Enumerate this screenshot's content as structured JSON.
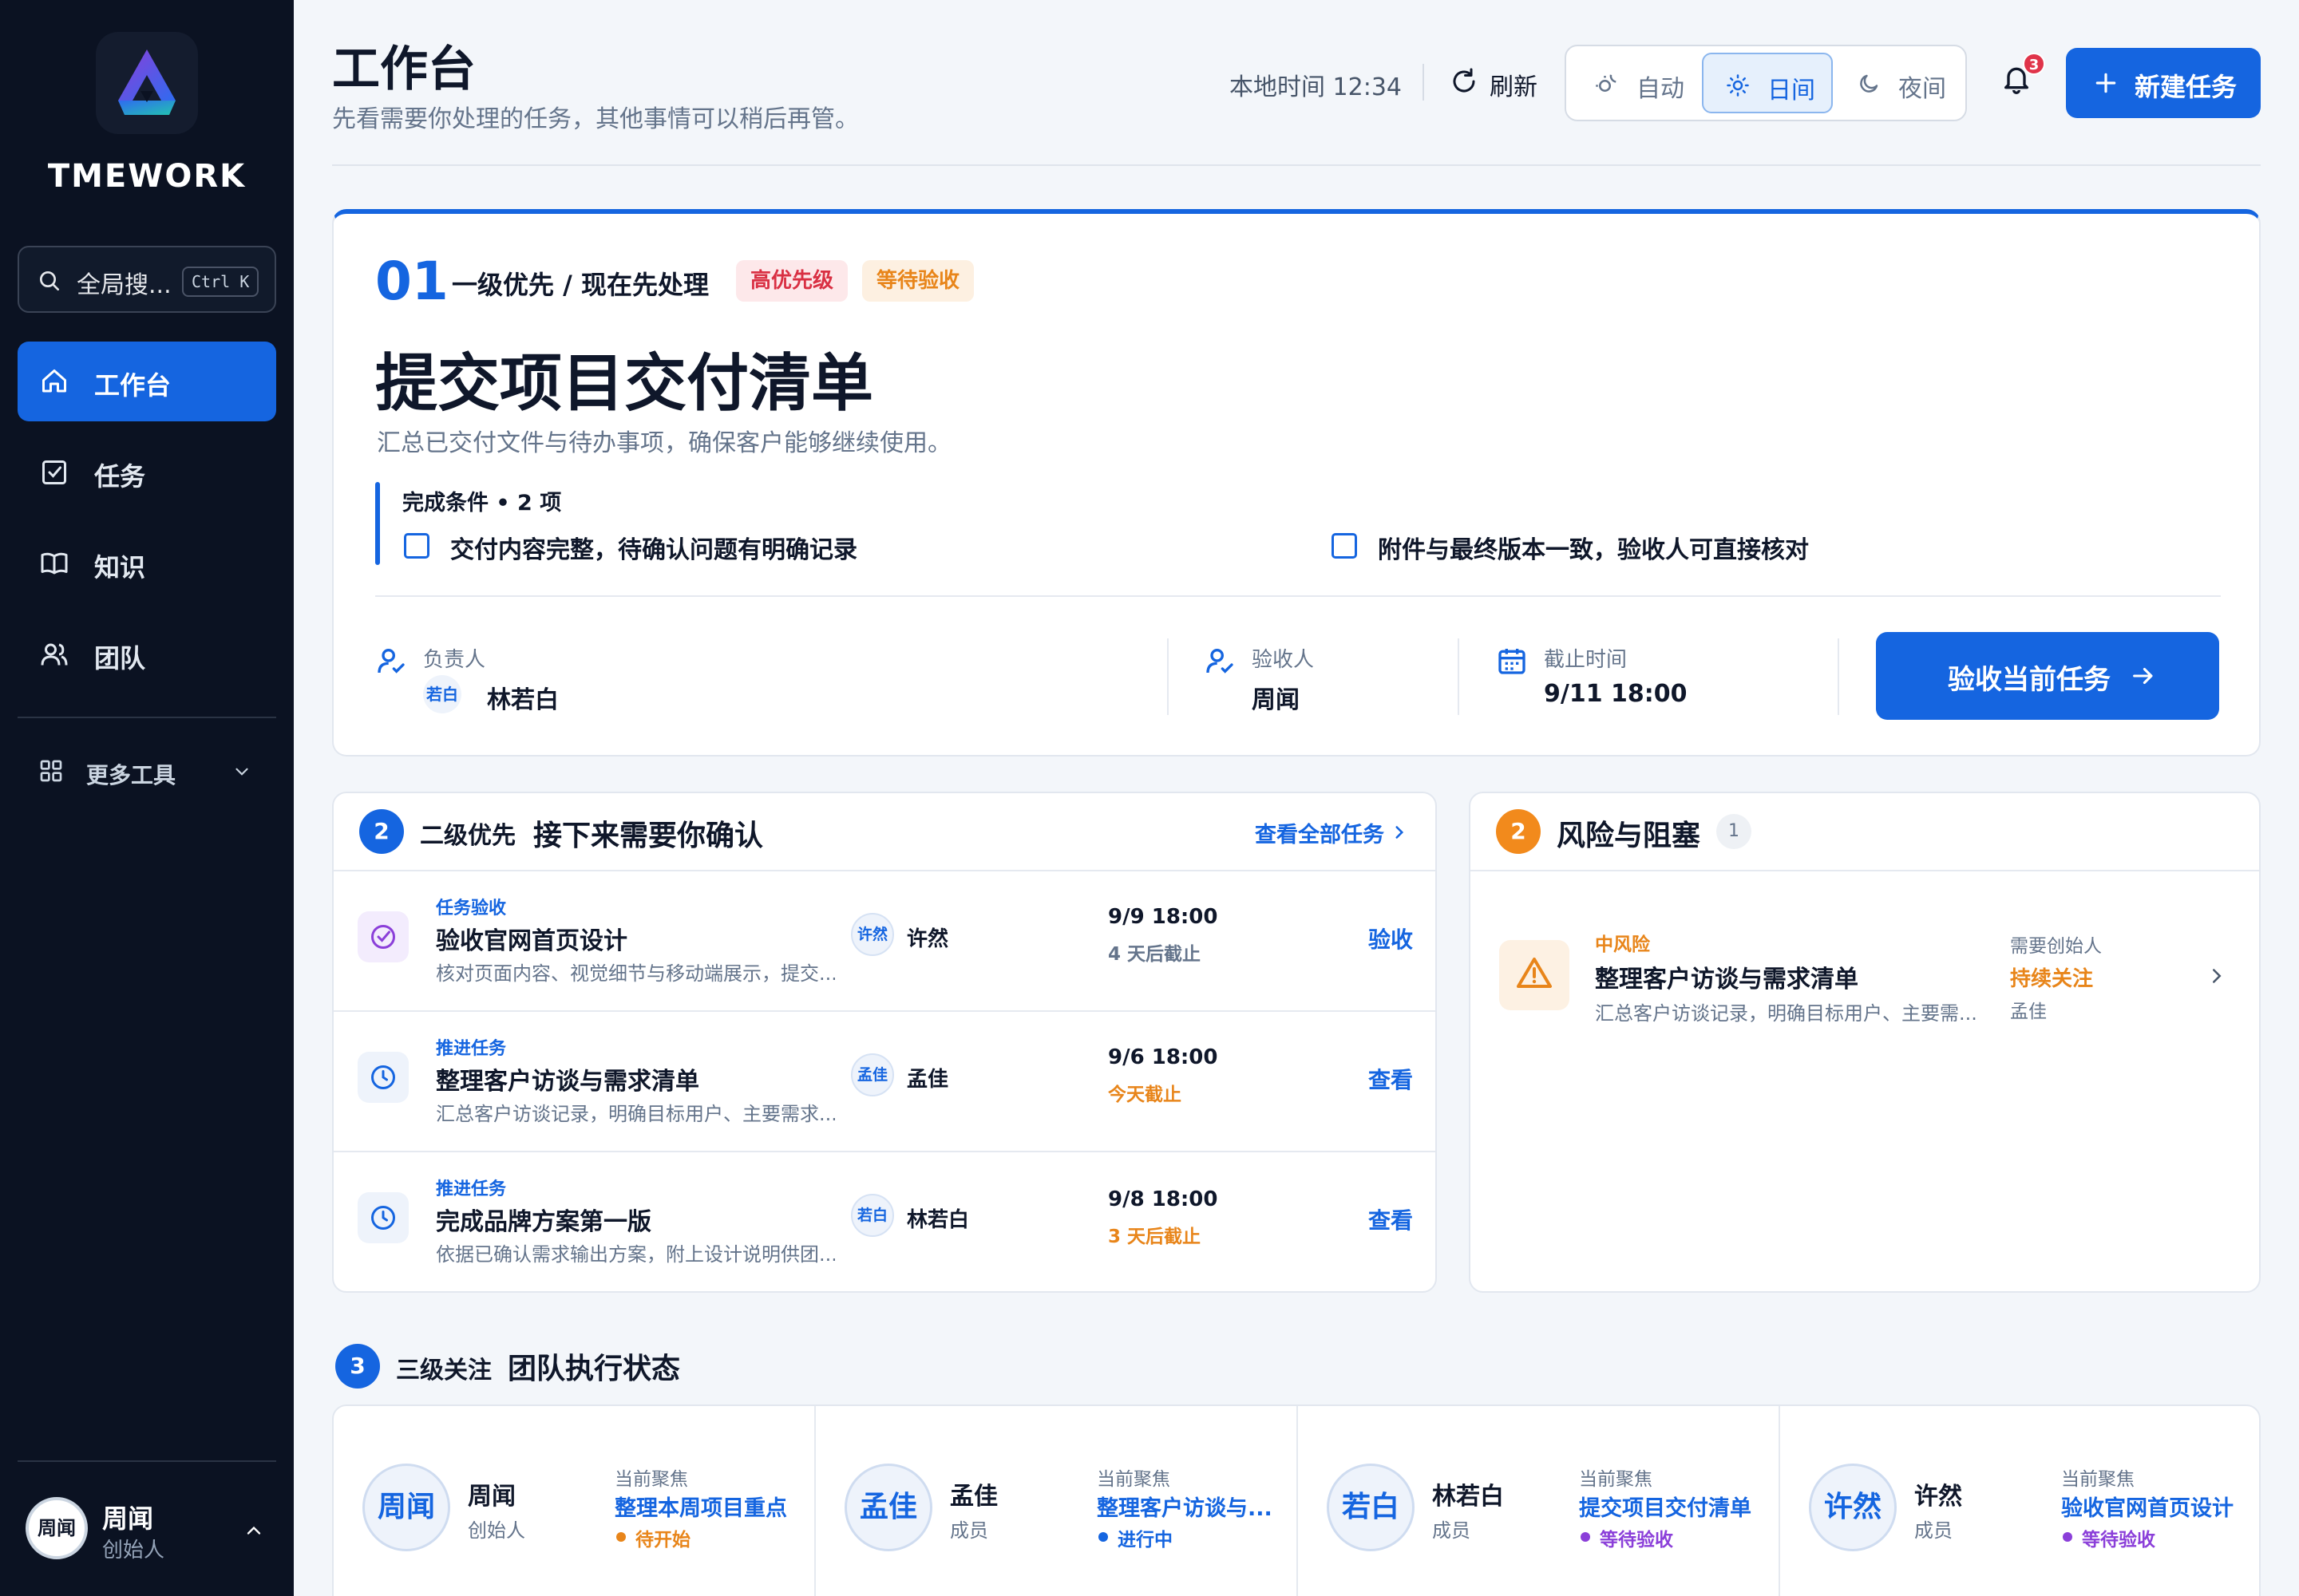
{
  "app": {
    "brand": "TMEWORK"
  },
  "sidebar": {
    "search": {
      "label": "全局搜...",
      "shortcut": "Ctrl K"
    },
    "nav": [
      {
        "label": "工作台",
        "icon": "home-icon",
        "active": true
      },
      {
        "label": "任务",
        "icon": "checkbox-icon"
      },
      {
        "label": "知识",
        "icon": "book-icon"
      },
      {
        "label": "团队",
        "icon": "users-icon"
      }
    ],
    "more_tools": "更多工具",
    "user": {
      "avatar": "周闻",
      "name": "周闻",
      "role": "创始人"
    }
  },
  "header": {
    "title": "工作台",
    "subtitle": "先看需要你处理的任务，其他事情可以稍后再管。",
    "local_time": "本地时间 12:34",
    "refresh": "刷新",
    "theme": {
      "auto": "自动",
      "day": "日间",
      "night": "夜间",
      "selected": "日间"
    },
    "notifications": "3",
    "new_task": "新建任务"
  },
  "priority1": {
    "number": "01",
    "level": "一级优先 / 现在先处理",
    "tags": [
      "高优先级",
      "等待验收"
    ],
    "title": "提交项目交付清单",
    "description": "汇总已交付文件与待办事项，确保客户能够继续使用。",
    "conditions_title": "完成条件 • 2 项",
    "conditions": [
      "交付内容完整，待确认问题有明确记录",
      "附件与最终版本一致，验收人可直接核对"
    ],
    "owner_label": "负责人",
    "owner_avatar": "若白",
    "owner_name": "林若白",
    "reviewer_label": "验收人",
    "reviewer_name": "周闻",
    "deadline_label": "截止时间",
    "deadline": "9/11 18:00",
    "action": "验收当前任务"
  },
  "priority2": {
    "number": "2",
    "level": "二级优先",
    "title": "接下来需要你确认",
    "view_all": "查看全部任务",
    "rows": [
      {
        "type": "任务验收",
        "title": "验收官网首页设计",
        "desc": "核对页面内容、视觉细节与移动端展示，提交...",
        "avatar": "许然",
        "name": "许然",
        "date": "9/9 18:00",
        "due": "4 天后截止",
        "action": "验收"
      },
      {
        "type": "推进任务",
        "title": "整理客户访谈与需求清单",
        "desc": "汇总客户访谈记录，明确目标用户、主要需求...",
        "avatar": "孟佳",
        "name": "孟佳",
        "date": "9/6 18:00",
        "due": "今天截止",
        "action": "查看"
      },
      {
        "type": "推进任务",
        "title": "完成品牌方案第一版",
        "desc": "依据已确认需求输出方案，附上设计说明供团...",
        "avatar": "若白",
        "name": "林若白",
        "date": "9/8 18:00",
        "due": "3 天后截止",
        "action": "查看"
      }
    ]
  },
  "risks": {
    "number": "2",
    "title": "风险与阻塞",
    "count": "1",
    "item": {
      "level": "中风险",
      "title": "整理客户访谈与需求清单",
      "desc": "汇总客户访谈记录，明确目标用户、主要需...",
      "need": "需要创始人",
      "status": "持续关注",
      "owner": "孟佳"
    }
  },
  "team": {
    "number": "3",
    "level": "三级关注",
    "title": "团队执行状态",
    "focus_label": "当前聚焦",
    "members": [
      {
        "avatar": "周闻",
        "name": "周闻",
        "role": "创始人",
        "focus": "整理本周项目重点",
        "status": "待开始",
        "status_color": "#e8851a"
      },
      {
        "avatar": "孟佳",
        "name": "孟佳",
        "role": "成员",
        "focus": "整理客户访谈与...",
        "status": "进行中",
        "status_color": "#1565e0"
      },
      {
        "avatar": "若白",
        "name": "林若白",
        "role": "成员",
        "focus": "提交项目交付清单",
        "status": "等待验收",
        "status_color": "#8b3fd9"
      },
      {
        "avatar": "许然",
        "name": "许然",
        "role": "成员",
        "focus": "验收官网首页设计",
        "status": "等待验收",
        "status_color": "#8b3fd9"
      }
    ]
  },
  "colors": {
    "primary": "#1565e0",
    "sidebar": "#0b1222",
    "warning": "#e8851a",
    "danger": "#d93043",
    "purple": "#8b3fd9"
  }
}
